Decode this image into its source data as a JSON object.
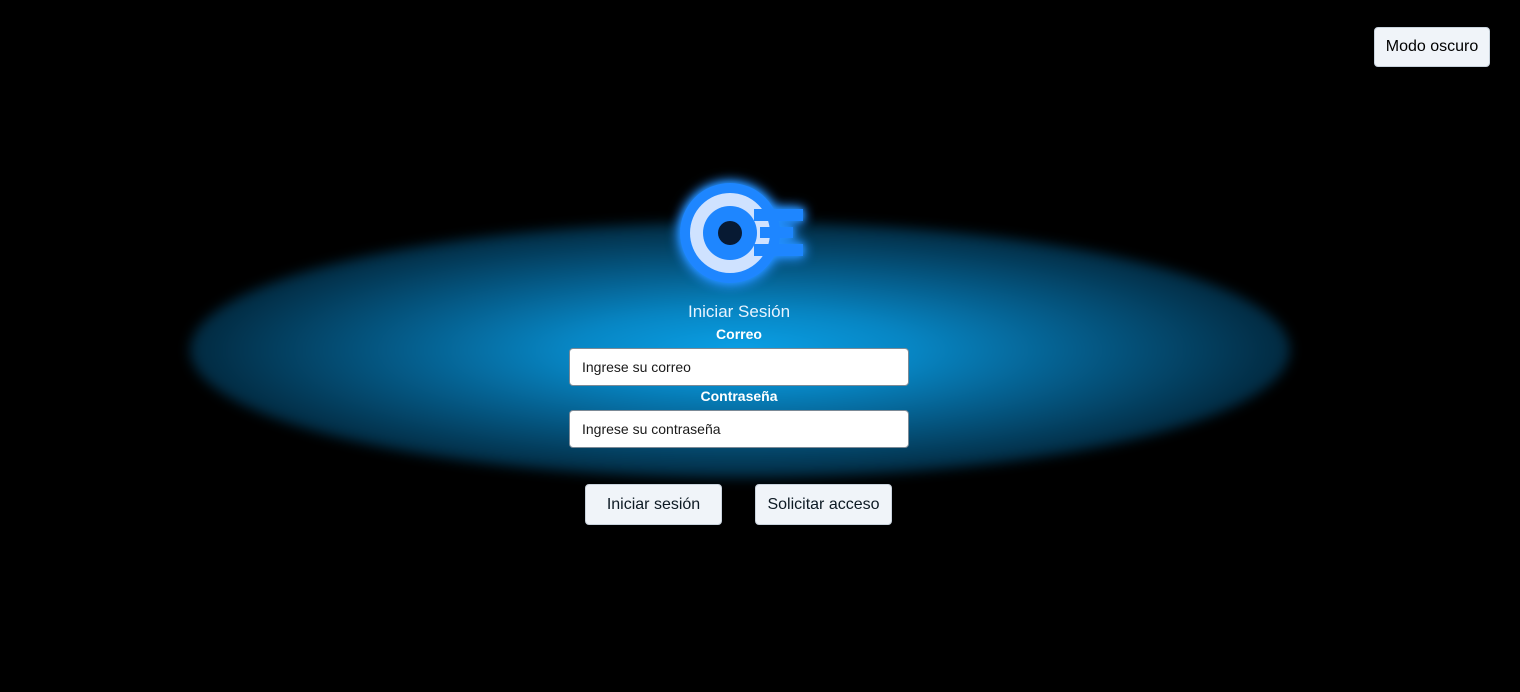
{
  "header": {
    "dark_mode_label": "Modo oscuro"
  },
  "logo": {
    "icon": "app-logo-icon",
    "color": "#1e86ff",
    "inner_color": "#cfe2ff"
  },
  "login": {
    "title": "Iniciar Sesión",
    "email_label": "Correo",
    "email_placeholder": "Ingrese su correo",
    "password_label": "Contraseña",
    "password_placeholder": "Ingrese su contraseña",
    "login_button": "Iniciar sesión",
    "request_button": "Solicitar acceso"
  },
  "theme": {
    "background": "#000000",
    "glow": "#0aa0e6",
    "button_bg": "#f0f4f9"
  }
}
